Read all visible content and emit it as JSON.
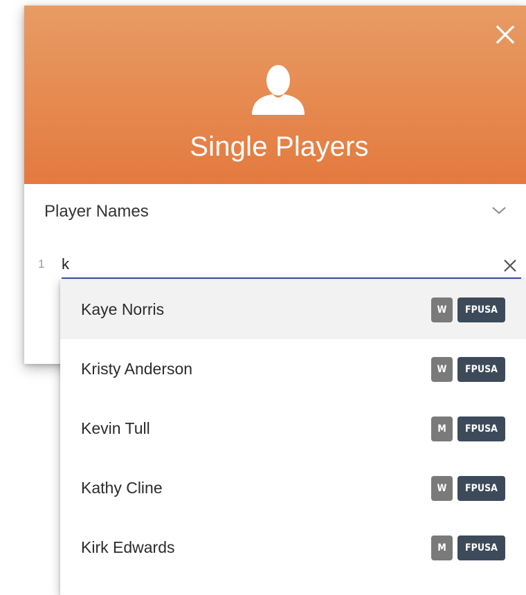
{
  "dialog": {
    "title": "Single Players",
    "close_icon": "close-icon",
    "avatar_icon": "person-icon",
    "header_gradient": [
      "#e79c64",
      "#e47a3f"
    ]
  },
  "section": {
    "title": "Player Names",
    "toggle_icon": "chevron-down-icon"
  },
  "input": {
    "row_number": "1",
    "value": "k",
    "clear_icon": "close-icon",
    "underline_color": "#3f51b5"
  },
  "suggestions": [
    {
      "name": "Kaye Norris",
      "gender": "W",
      "org": "FPUSA",
      "highlighted": true
    },
    {
      "name": "Kristy Anderson",
      "gender": "W",
      "org": "FPUSA",
      "highlighted": false
    },
    {
      "name": "Kevin Tull",
      "gender": "M",
      "org": "FPUSA",
      "highlighted": false
    },
    {
      "name": "Kathy Cline",
      "gender": "W",
      "org": "FPUSA",
      "highlighted": false
    },
    {
      "name": "Kirk Edwards",
      "gender": "M",
      "org": "FPUSA",
      "highlighted": false
    }
  ]
}
